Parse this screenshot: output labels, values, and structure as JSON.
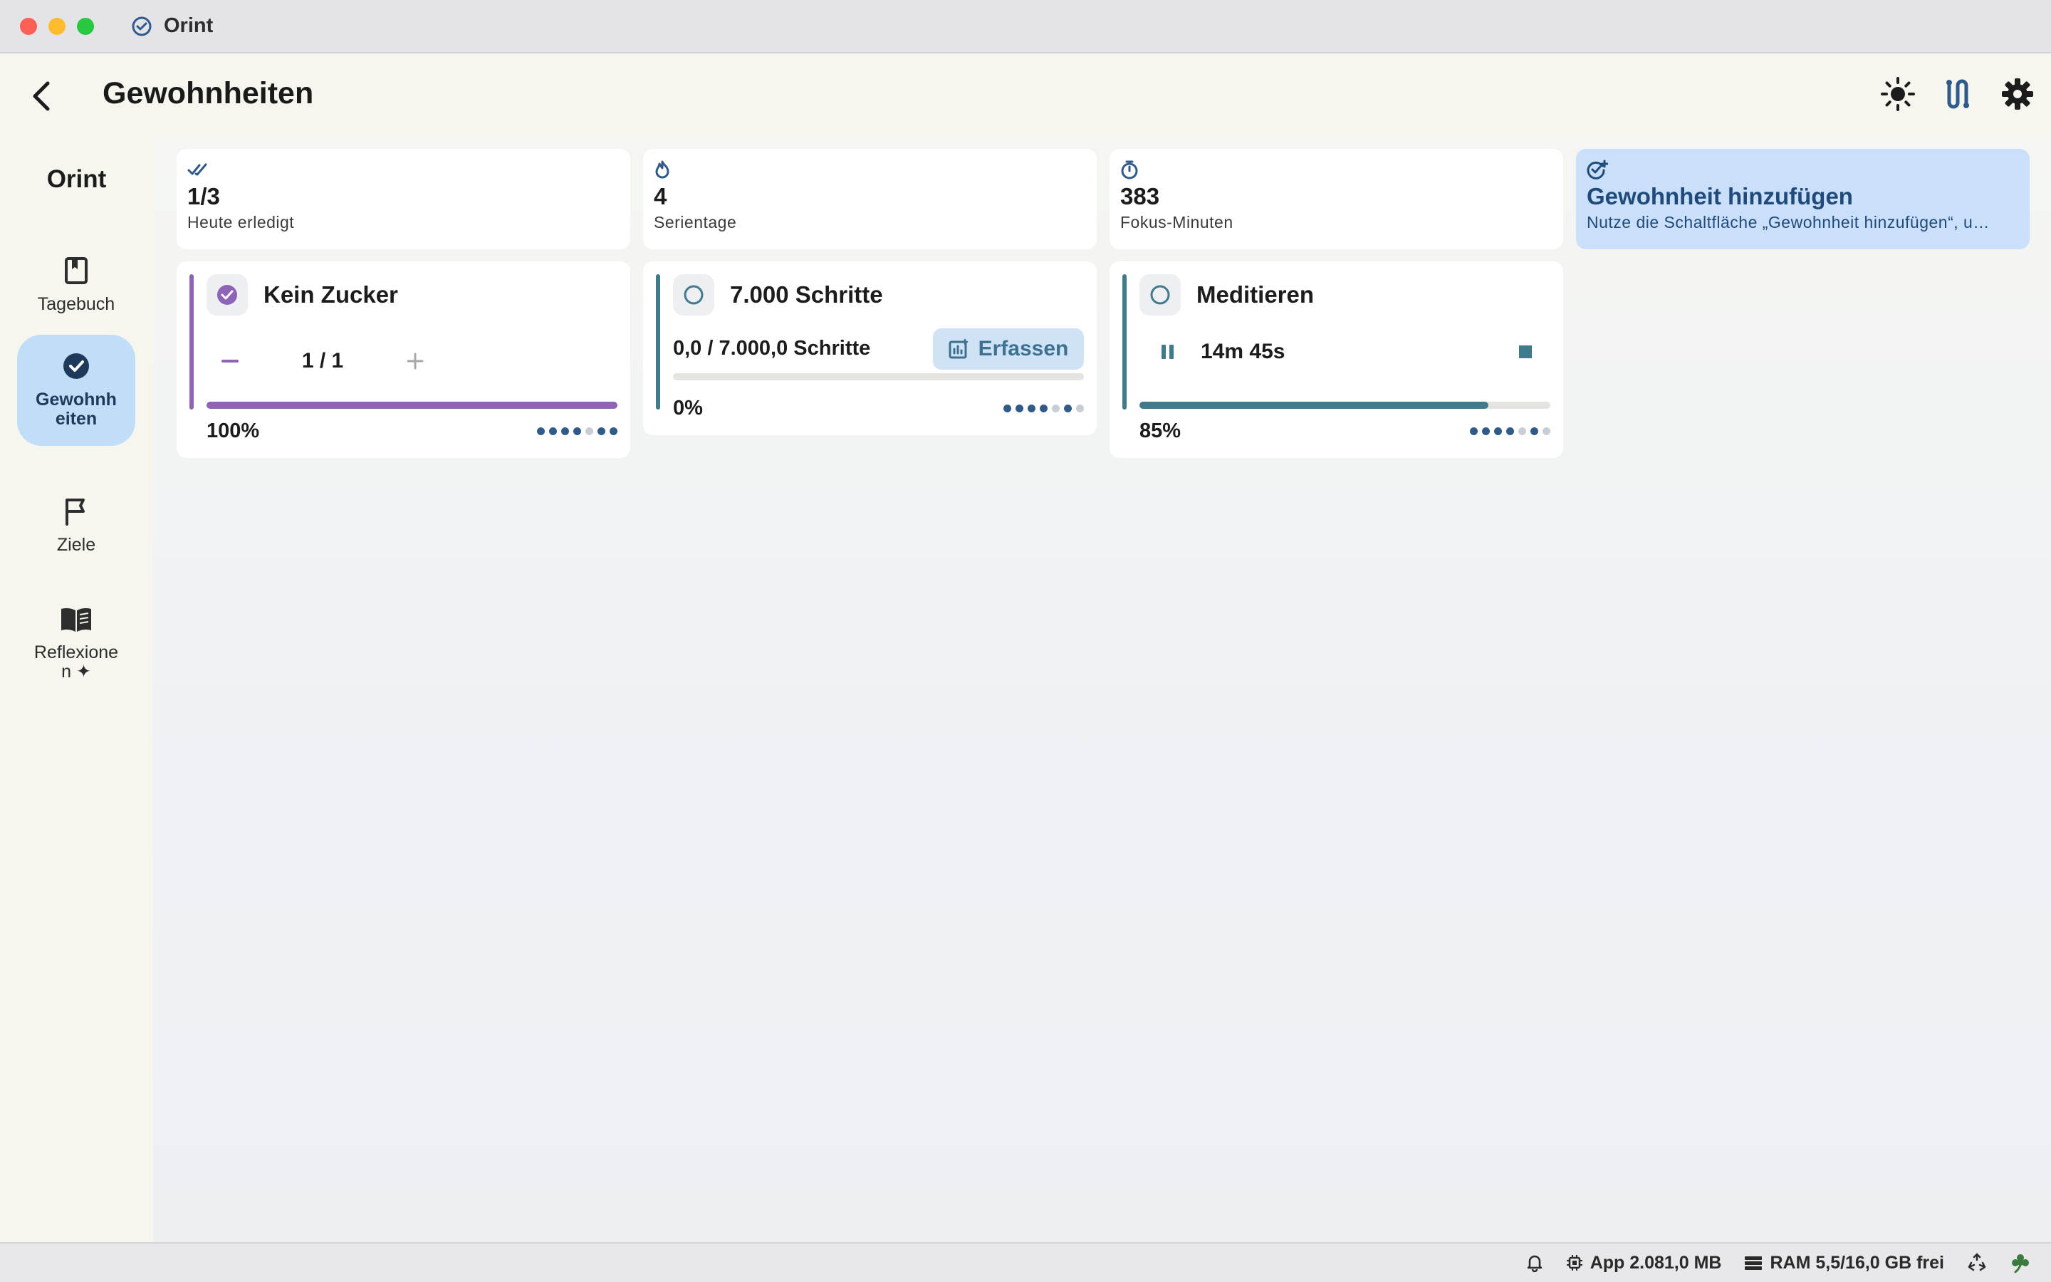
{
  "window": {
    "title": "Orint"
  },
  "header": {
    "title": "Gewohnheiten"
  },
  "sidebar": {
    "brand": "Orint",
    "items": [
      {
        "label": "Tagebuch",
        "icon": "bookmark-icon",
        "active": false
      },
      {
        "label": "Gewohnh\neiten",
        "icon": "check-circle-icon",
        "active": true
      },
      {
        "label": "Ziele",
        "icon": "flag-icon",
        "active": false
      },
      {
        "label": "Reflexione\nn ✦",
        "icon": "book-open-icon",
        "active": false
      }
    ]
  },
  "stats": [
    {
      "value": "1/3",
      "label": "Heute erledigt",
      "icon": "double-check-icon"
    },
    {
      "value": "4",
      "label": "Serientage",
      "icon": "flame-icon"
    },
    {
      "value": "383",
      "label": "Fokus-Minuten",
      "icon": "stopwatch-icon"
    },
    {
      "value": "Gewohnheit hinzufügen",
      "label": "Nutze die Schaltfläche „Gewohnheit hinzufügen“, u…",
      "icon": "add-check-icon"
    }
  ],
  "habits": {
    "sugar": {
      "name": "Kein Zucker",
      "count": "1 / 1",
      "percent": "100%",
      "progress": 1.0,
      "color": "#8f63b8",
      "week": [
        1,
        1,
        1,
        1,
        0,
        1,
        1
      ]
    },
    "steps": {
      "name": "7.000 Schritte",
      "amount": "0,0 / 7.000,0 Schritte",
      "action": "Erfassen",
      "percent": "0%",
      "progress": 0.0,
      "color": "#3f7b8c",
      "week": [
        1,
        1,
        1,
        1,
        0,
        1,
        0
      ]
    },
    "meditate": {
      "name": "Meditieren",
      "timer": "14m 45s",
      "percent": "85%",
      "progress": 0.85,
      "color": "#3f7b8c",
      "week": [
        1,
        1,
        1,
        1,
        0,
        1,
        0
      ]
    }
  },
  "statusbar": {
    "app_mem": "App 2.081,0 MB",
    "ram": "RAM 5,5/16,0 GB frei"
  },
  "colors": {
    "accent": "#c1def8",
    "accent_text": "#1f4a7a",
    "purple": "#8f63b8",
    "teal": "#3f7b8c",
    "dot_on": "#2f5a8a",
    "dot_off": "#c9cdd4"
  }
}
